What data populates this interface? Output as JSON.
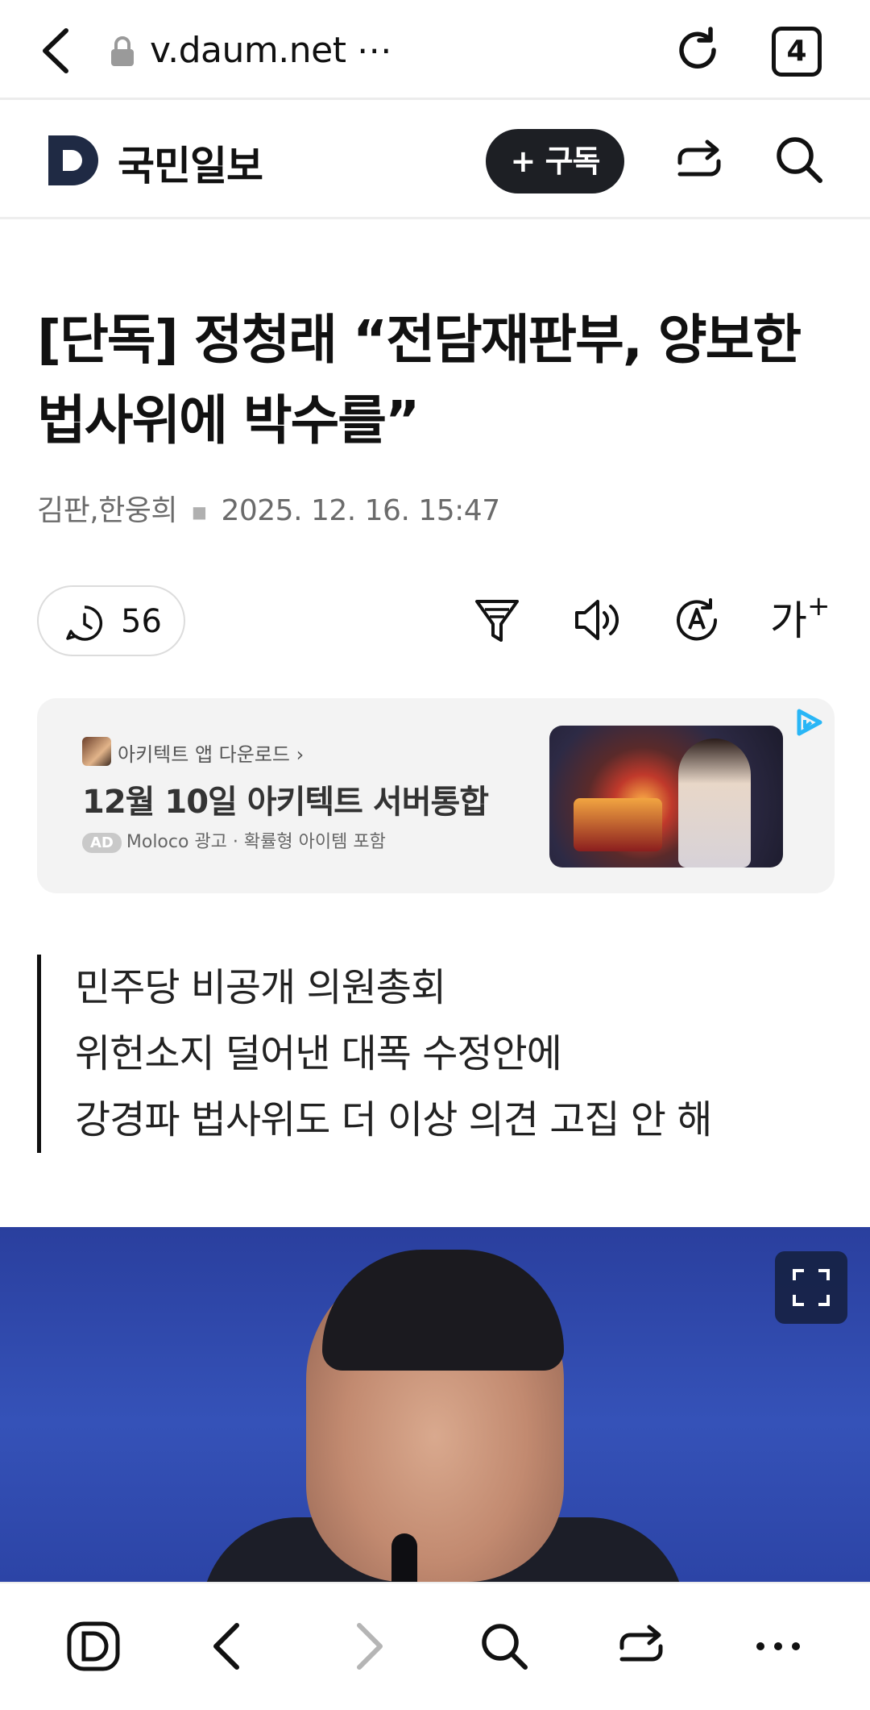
{
  "browser": {
    "url": "v.daum.net ⋯",
    "tab_count": "4",
    "icons": {
      "back": "back-arrow-icon",
      "lock": "lock-icon",
      "reload": "reload-icon"
    }
  },
  "header": {
    "press_name": "국민일보",
    "subscribe_label": "+ 구독",
    "icons": {
      "logo": "daum-logo-icon",
      "share": "share-icon",
      "search": "search-icon"
    }
  },
  "article": {
    "headline": "[단독] 정청래 “전담재판부, 양보한 법사위에 박수를”",
    "authors": "김판,한웅희",
    "timestamp": "2025. 12. 16. 15:47",
    "comment_count": "56",
    "tools": {
      "font_size_label": "가",
      "icons": [
        "comment-clock-icon",
        "summary-filter-icon",
        "read-aloud-icon",
        "translate-icon",
        "font-size-icon"
      ]
    },
    "summary": [
      "민주당 비공개 의원총회",
      "위헌소지 덜어낸 대폭 수정안에",
      "강경파 법사위도 더 이상 의견 고집 안 해"
    ]
  },
  "ad": {
    "cta": "아키텍트 앱 다운로드 ›",
    "title": "12월 10일 아키텍트 서버통합",
    "badge": "AD",
    "meta": "Moloco 광고 · 확률형 아이템 포함"
  },
  "bottom_nav": {
    "icons": [
      "daum-home-icon",
      "nav-back-icon",
      "nav-forward-icon",
      "search-icon",
      "share-icon",
      "more-icon"
    ]
  },
  "colors": {
    "accent_dark": "#1d1f24",
    "ad_badge": "#c9c9c9",
    "ad_corner": "#29b6f6"
  }
}
